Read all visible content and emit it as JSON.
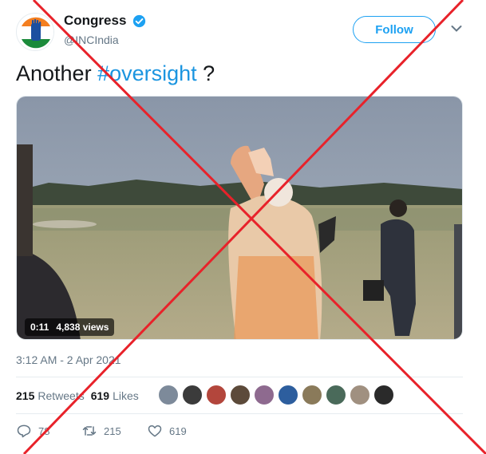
{
  "account": {
    "name": "Congress",
    "handle": "@INCIndia",
    "follow_label": "Follow",
    "avatar_icon": "congress-hand-logo",
    "verified_icon": "verified-badge-icon"
  },
  "tweet": {
    "text_prefix": "Another ",
    "hashtag": "#oversight",
    "text_suffix": " ?",
    "timestamp": "3:12 AM - 2 Apr 2021"
  },
  "video": {
    "duration": "0:11",
    "views": "4,838 views"
  },
  "stats": {
    "retweets_count": "215",
    "retweets_label": "Retweets",
    "likes_count": "619",
    "likes_label": "Likes"
  },
  "actions": {
    "reply_count": "78",
    "retweet_count": "215",
    "like_count": "619"
  },
  "colors": {
    "accent": "#1da1f2",
    "hashtag": "#1b95e0",
    "cross": "#e8222a"
  }
}
